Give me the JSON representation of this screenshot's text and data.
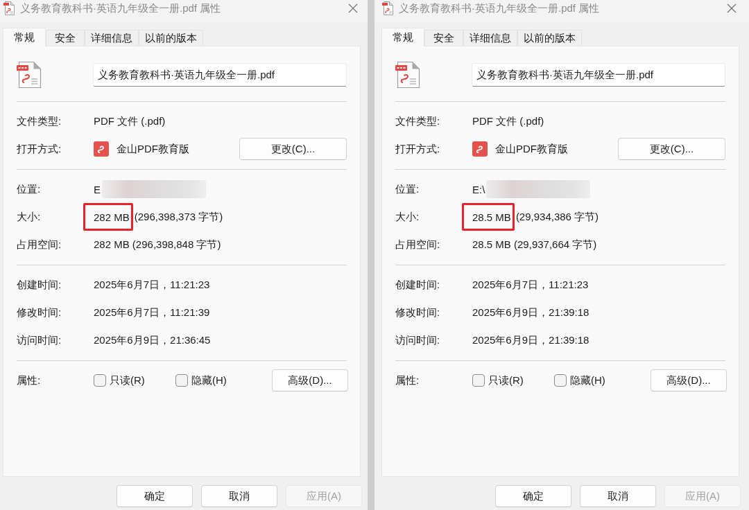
{
  "dialogs": [
    {
      "title": "义务教育教科书·英语九年级全一册.pdf 属性",
      "tabs": [
        {
          "label": "常规",
          "selected": true
        },
        {
          "label": "安全",
          "selected": false
        },
        {
          "label": "详细信息",
          "selected": false
        },
        {
          "label": "以前的版本",
          "selected": false
        }
      ],
      "file_name": "义务教育教科书·英语九年级全一册.pdf",
      "sections": [
        {
          "rows": [
            {
              "kind": "text",
              "label": "文件类型:",
              "value": "PDF 文件 (.pdf)"
            },
            {
              "kind": "app",
              "label": "打开方式:",
              "value": "金山PDF教育版",
              "button": "更改(C)..."
            }
          ]
        },
        {
          "rows": [
            {
              "kind": "redacted",
              "label": "位置:",
              "value": "E"
            },
            {
              "kind": "highlighted",
              "label": "大小:",
              "highlight": "282 MB",
              "value": "(296,398,373 字节)"
            },
            {
              "kind": "text",
              "label": "占用空间:",
              "value": "282 MB (296,398,848 字节)"
            }
          ]
        },
        {
          "rows": [
            {
              "kind": "text",
              "label": "创建时间:",
              "value": "2025年6月7日，11:21:23"
            },
            {
              "kind": "text",
              "label": "修改时间:",
              "value": "2025年6月7日，11:21:39"
            },
            {
              "kind": "text",
              "label": "访问时间:",
              "value": "2025年6月9日，21:36:45"
            }
          ]
        }
      ],
      "attributes": {
        "label": "属性:",
        "checkboxes": [
          {
            "label": "只读(R)",
            "checked": false
          },
          {
            "label": "隐藏(H)",
            "checked": false
          }
        ],
        "button": "高级(D)..."
      },
      "buttons": [
        {
          "label": "确定",
          "disabled": false
        },
        {
          "label": "取消",
          "disabled": false
        },
        {
          "label": "应用(A)",
          "disabled": true
        }
      ]
    },
    {
      "title": "义务教育教科书·英语九年级全一册.pdf 属性",
      "tabs": [
        {
          "label": "常规",
          "selected": true
        },
        {
          "label": "安全",
          "selected": false
        },
        {
          "label": "详细信息",
          "selected": false
        },
        {
          "label": "以前的版本",
          "selected": false
        }
      ],
      "file_name": "义务教育教科书·英语九年级全一册.pdf",
      "sections": [
        {
          "rows": [
            {
              "kind": "text",
              "label": "文件类型:",
              "value": "PDF 文件 (.pdf)"
            },
            {
              "kind": "app",
              "label": "打开方式:",
              "value": "金山PDF教育版",
              "button": "更改(C)..."
            }
          ]
        },
        {
          "rows": [
            {
              "kind": "redacted",
              "label": "位置:",
              "value": "E:\\"
            },
            {
              "kind": "highlighted",
              "label": "大小:",
              "highlight": "28.5 MB",
              "value": "(29,934,386 字节)"
            },
            {
              "kind": "text",
              "label": "占用空间:",
              "value": "28.5 MB (29,937,664 字节)"
            }
          ]
        },
        {
          "rows": [
            {
              "kind": "text",
              "label": "创建时间:",
              "value": "2025年6月7日，11:21:23"
            },
            {
              "kind": "text",
              "label": "修改时间:",
              "value": "2025年6月9日，21:39:18"
            },
            {
              "kind": "text",
              "label": "访问时间:",
              "value": "2025年6月9日，21:39:18"
            }
          ]
        }
      ],
      "attributes": {
        "label": "属性:",
        "checkboxes": [
          {
            "label": "只读(R)",
            "checked": false
          },
          {
            "label": "隐藏(H)",
            "checked": false
          }
        ],
        "button": "高级(D)..."
      },
      "buttons": [
        {
          "label": "确定",
          "disabled": false
        },
        {
          "label": "取消",
          "disabled": false
        },
        {
          "label": "应用(A)",
          "disabled": true
        }
      ]
    }
  ]
}
